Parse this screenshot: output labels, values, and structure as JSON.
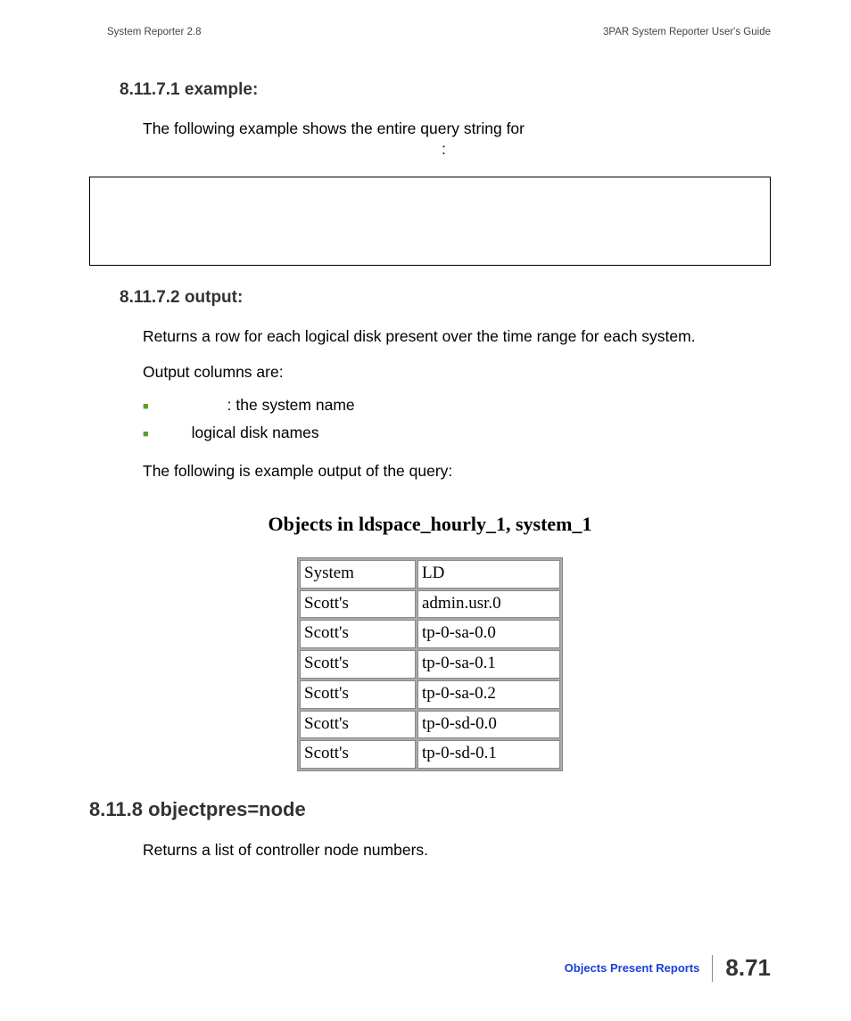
{
  "header": {
    "left": "System Reporter 2.8",
    "right": "3PAR System Reporter User's Guide"
  },
  "sections": {
    "example_heading": "8.11.7.1 example:",
    "example_intro": "The following example shows the entire query string for",
    "example_colon": ":",
    "output_heading": "8.11.7.2 output:",
    "output_intro": "Returns a row for each logical disk present over the time range for each system.",
    "output_cols": "Output columns are:",
    "bullets": [
      {
        "prefix_gap": "gap1",
        "text": ": the system name"
      },
      {
        "prefix_gap": "gap2",
        "text": "logical disk names"
      }
    ],
    "output_example_lead": "The following is example output of the query:",
    "figure_caption": "Objects in ldspace_hourly_1, system_1",
    "next_heading": "8.11.8 objectpres=node",
    "next_body": "Returns a list of controller node numbers."
  },
  "table": {
    "rows": [
      [
        "System",
        "LD"
      ],
      [
        "Scott's",
        "admin.usr.0"
      ],
      [
        "Scott's",
        "tp-0-sa-0.0"
      ],
      [
        "Scott's",
        "tp-0-sa-0.1"
      ],
      [
        "Scott's",
        "tp-0-sa-0.2"
      ],
      [
        "Scott's",
        "tp-0-sd-0.0"
      ],
      [
        "Scott's",
        "tp-0-sd-0.1"
      ]
    ]
  },
  "footer": {
    "link": "Objects Present Reports",
    "page": "8.71"
  }
}
